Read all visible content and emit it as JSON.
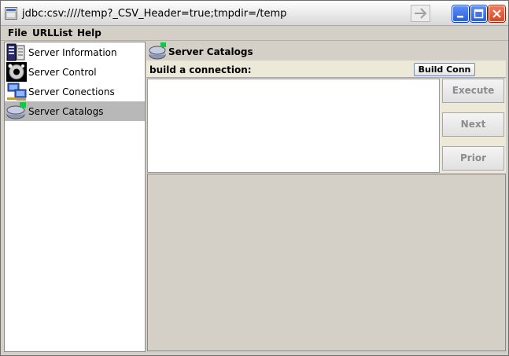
{
  "window": {
    "title": "jdbc:csv:////temp?_CSV_Header=true;tmpdir=/temp"
  },
  "menu": {
    "items": [
      {
        "label": "File"
      },
      {
        "label": "URLList"
      },
      {
        "label": "Help"
      }
    ]
  },
  "nav": {
    "items": [
      {
        "label": "Server Information",
        "icon": "server-info-icon"
      },
      {
        "label": "Server Control",
        "icon": "gear-icon"
      },
      {
        "label": "Server Conections",
        "icon": "computers-network-icon"
      },
      {
        "label": "Server Catalogs",
        "icon": "disk-catalog-icon",
        "selected": true
      }
    ]
  },
  "panel": {
    "title": "Server Catalogs",
    "connection_label": "build a connection:",
    "build_button": "Build Conn",
    "execute_button": "Execute",
    "next_button": "Next",
    "prior_button": "Prior"
  },
  "colors": {
    "selected_row": "#b8b8b8",
    "disabled_text": "#8c8c8c",
    "minimize_maximize": "#2a5fe0",
    "close": "#d24a2a"
  }
}
